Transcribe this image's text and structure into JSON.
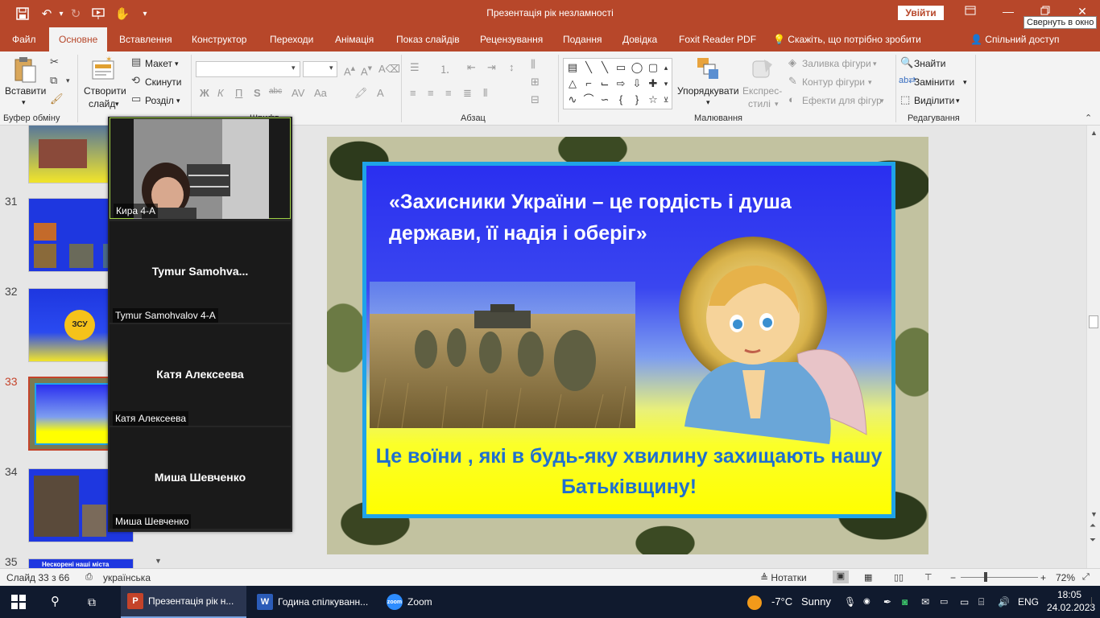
{
  "window": {
    "title": "Презентація рік незламності",
    "signin": "Увійти",
    "tooltip": "Свернуть в окно"
  },
  "tabs": [
    "Файл",
    "Основне",
    "Вставлення",
    "Конструктор",
    "Переходи",
    "Анімація",
    "Показ слайдів",
    "Рецензування",
    "Подання",
    "Довідка",
    "Foxit Reader PDF"
  ],
  "tell_me": "Скажіть, що потрібно зробити",
  "share": "Спільний доступ",
  "ribbon": {
    "paste": "Вставити",
    "clipboard_group": "Буфер обміну",
    "new_slide_1": "Створити",
    "new_slide_2": "слайд",
    "layout": "Макет",
    "reset": "Скинути",
    "section": "Розділ",
    "font_group": "Шрифт",
    "paragraph_group": "Абзац",
    "arrange_1": "Упорядкувати",
    "quick_styles_1": "Експрес-",
    "quick_styles_2": "стилі",
    "shape_fill": "Заливка фігури",
    "shape_outline": "Контур фігури",
    "shape_effects": "Ефекти для фігур",
    "drawing_group": "Малювання",
    "find": "Знайти",
    "replace": "Замінити",
    "select": "Виділити",
    "editing_group": "Редагування",
    "bold": "Ж",
    "italic": "К",
    "underline": "П",
    "shadow": "S"
  },
  "thumbnails": [
    {
      "num": "31"
    },
    {
      "num": "32"
    },
    {
      "num": "33"
    },
    {
      "num": "34"
    },
    {
      "num": "35"
    }
  ],
  "thumb_text": {
    "t32_center": "ЗСУ",
    "t35_banner": "Нескорені наші міста"
  },
  "zoom": {
    "participants": [
      {
        "label": "Кира 4-А",
        "center": ""
      },
      {
        "label": "Tymur Samohvalov 4-A",
        "center": "Tymur  Samohva..."
      },
      {
        "label": "Катя Алексеева",
        "center": "Катя Алексеева"
      },
      {
        "label": "Миша Шевченко",
        "center": "Миша Шевченко"
      }
    ]
  },
  "slide": {
    "title": "«Захисники України – це гордість і душа держави, її надія і оберіг»",
    "subtitle": "Це воїни , які в будь-яку хвилину  захищають нашу  Батьківщину!"
  },
  "status": {
    "slide_of": "Слайд 33 з 66",
    "language": "українська",
    "notes": "Нотатки",
    "zoom": "72%"
  },
  "taskbar": {
    "ppt": "Презентація рік н...",
    "word": "Година спілкуванн...",
    "zoom_app": "Zoom",
    "temp": "-7°C",
    "weather": "Sunny",
    "lang": "ENG",
    "time": "18:05",
    "date": "24.02.2023"
  },
  "colors": {
    "accent": "#b7472a",
    "slide_frame": "#1fa3e8",
    "slide_sub_text": "#1f6fd0",
    "zoom_active_border": "#9ed044"
  }
}
